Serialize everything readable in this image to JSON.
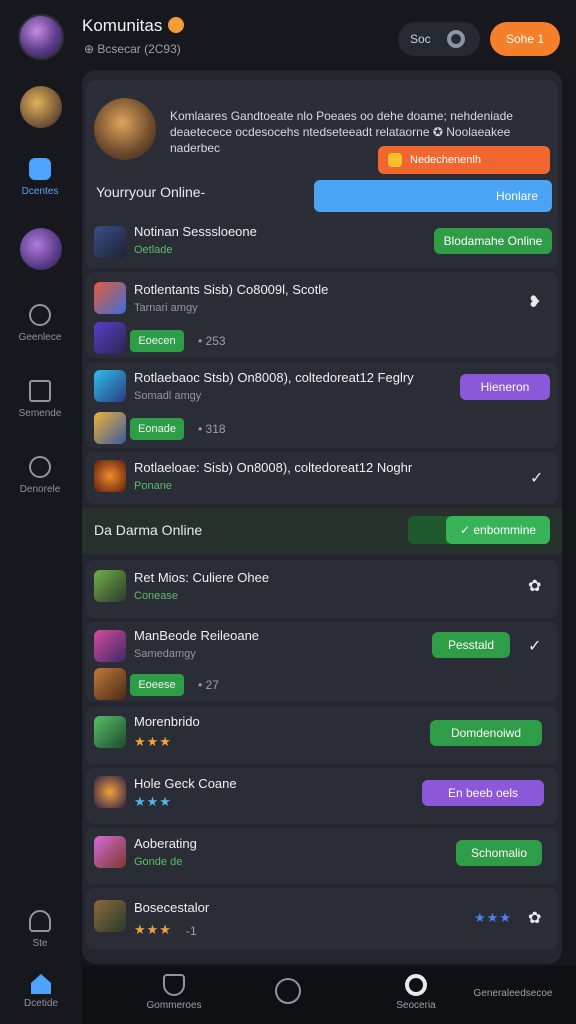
{
  "header": {
    "title": "Komunitas",
    "subtitle": "⊕ Bcsecar (2C93)",
    "pill_label": "Soc",
    "action_label": "Sohe 1"
  },
  "sidebar": {
    "items": [
      {
        "label": "Dcentes"
      },
      {
        "label": "Geenlece"
      },
      {
        "label": "Semende"
      },
      {
        "label": "Denorele"
      },
      {
        "label": "Ste"
      }
    ],
    "home_label": "Dcetide"
  },
  "hero": {
    "text": "Komlaares Gandtoeate nlo Poeaes oo dehe doame; nehdeniade deaetecece ocdesocehs ntedseteeadt relataorne ✪ Noolaeakee naderbec",
    "tag_label": "Nedechenenlh",
    "online_label": "Yourryour Online-",
    "cta_label": "Honlare"
  },
  "rows": [
    {
      "title": "Notinan Sesssloeone",
      "sub": "Oetlade",
      "button": "Blodamahe Online"
    },
    {
      "title": "Rotlentants Sisb) Co8009l, Scotle",
      "sub": "Tarnari amgy",
      "badge": "Eoecen",
      "count": "• 253"
    },
    {
      "title": "Rotlaebaoc Stsb) On8008), coltedoreat12 Feglry",
      "sub": "Somadl amgy",
      "badge": "Eonade",
      "count": "• 318",
      "button": "Hieneron"
    },
    {
      "title": "Rotlaeloae: Sisb) On8008), coltedoreat12 Noghr",
      "sub": "Ponane"
    }
  ],
  "section": {
    "title": "Da Darma Online",
    "toggle_label": "✓ enbommine"
  },
  "rows2": [
    {
      "title": "Ret Mios: Culiere Ohee",
      "sub": "Conease"
    },
    {
      "title": "ManBeode Reileoane",
      "sub": "Samedamgy",
      "badge": "Eoeese",
      "count": "• 27",
      "button": "Pesstald"
    },
    {
      "title": "Morenbrido",
      "stars": "★★★",
      "button": "Domdenoiwd"
    },
    {
      "title": "Hole Geck Coane",
      "stars": "★★★",
      "button": "En beeb oels"
    },
    {
      "title": "Aoberating",
      "sub": "Gonde de",
      "button": "Schomalio"
    },
    {
      "title": "Bosecestalor",
      "stars": "★★★",
      "count": "-1",
      "stars2": "★★★"
    }
  ],
  "bottom": {
    "items": [
      {
        "label": "Gommeroes"
      },
      {
        "label": ""
      },
      {
        "label": "Seoceria"
      },
      {
        "label": "Generaleedsecoe"
      }
    ]
  }
}
